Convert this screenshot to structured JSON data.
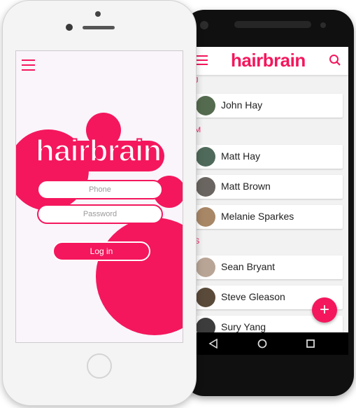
{
  "colors": {
    "accent": "#f4175d",
    "screen_bg": "#faf4fb"
  },
  "iphone": {
    "logo": "hairbrain",
    "menu_icon": "hamburger-icon",
    "phone_placeholder": "Phone",
    "password_placeholder": "Password",
    "login_label": "Log in"
  },
  "android": {
    "logo": "hairbrain",
    "menu_icon": "hamburger-icon",
    "search_icon": "search-icon",
    "sections": [
      "J",
      "M",
      "S"
    ],
    "contacts": [
      {
        "name": "John Hay",
        "section": "J"
      },
      {
        "name": "Matt Hay",
        "section": "M"
      },
      {
        "name": "Matt Brown",
        "section": "M"
      },
      {
        "name": "Melanie Sparkes",
        "section": "M"
      },
      {
        "name": "Sean Bryant",
        "section": "S"
      },
      {
        "name": "Steve Gleason",
        "section": "S"
      },
      {
        "name": "Sury Yang",
        "section": "S"
      }
    ],
    "fab_label": "+",
    "nav_icons": [
      "back-icon",
      "home-icon",
      "recents-icon"
    ]
  }
}
